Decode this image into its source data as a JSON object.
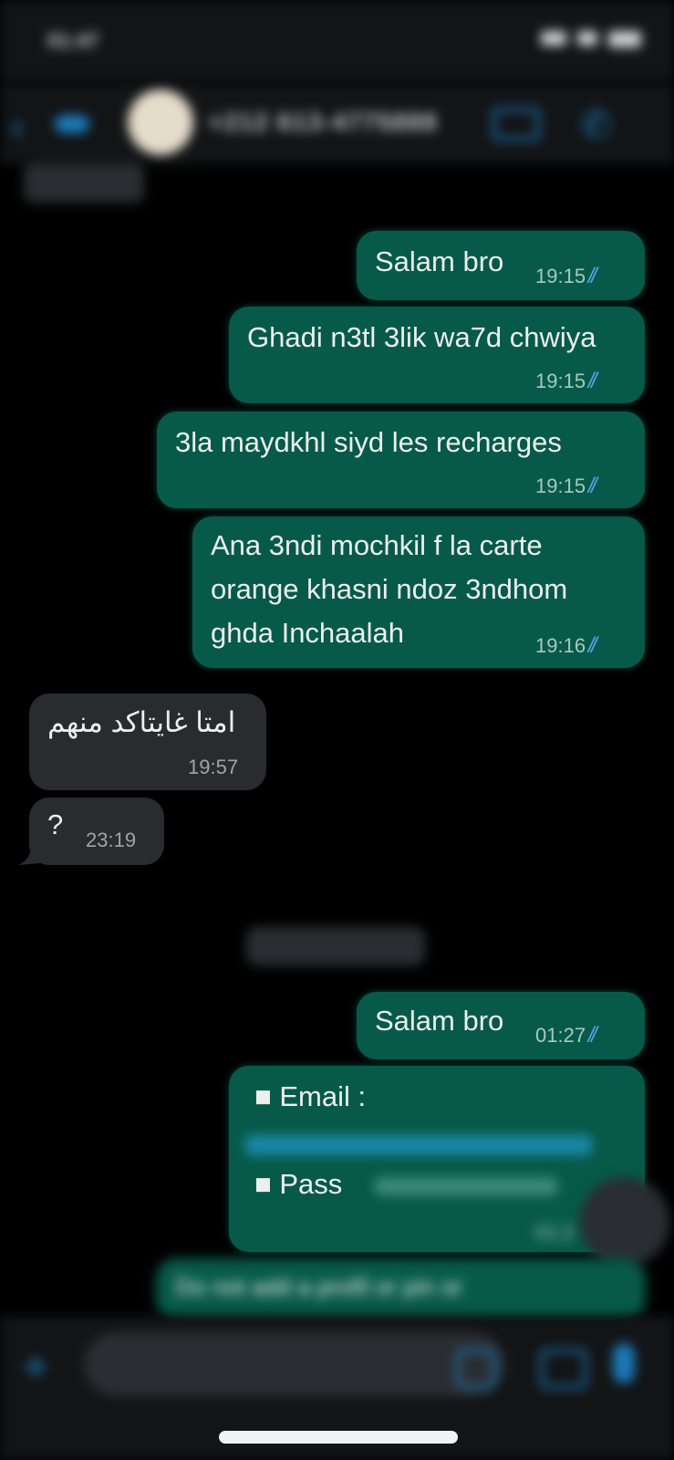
{
  "status": {
    "time": "01:47"
  },
  "header": {
    "contact": "+212 613-4775888"
  },
  "messages": [
    {
      "dir": "out",
      "text": "Salam bro",
      "time": "19:15"
    },
    {
      "dir": "out",
      "text": "Ghadi n3tl 3lik wa7d chwiya",
      "time": "19:15"
    },
    {
      "dir": "out",
      "text": "3la maydkhl siyd les recharges",
      "time": "19:15"
    },
    {
      "dir": "out",
      "lines": [
        "Ana 3ndi mochkil f la carte",
        "orange khasni ndoz 3ndhom",
        "ghda Inchaalah"
      ],
      "time": "19:16"
    },
    {
      "dir": "in",
      "text": "امتا غايتاكد منهم",
      "time": "19:57"
    },
    {
      "dir": "in",
      "text": "?",
      "time": "23:19"
    },
    {
      "dir": "out",
      "text": "Salam bro",
      "time": "01:27"
    },
    {
      "dir": "out",
      "email_label": "■ Email :",
      "pass_label": "■ Pass",
      "time": "01:2"
    },
    {
      "dir": "out",
      "text": "Do not add a profil or pin or"
    }
  ],
  "colors": {
    "outgoing": "#075a49",
    "incoming": "#2a2b2e",
    "accent": "#1c79b8"
  }
}
